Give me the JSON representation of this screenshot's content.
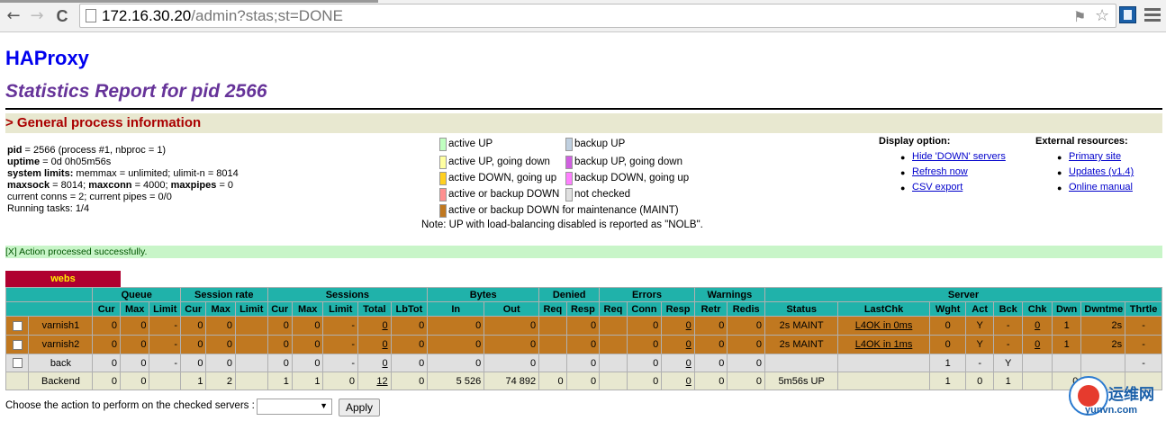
{
  "browser": {
    "url_host": "172.16.30.20",
    "url_path": "/admin?stas;st=DONE",
    "back_glyph": "←",
    "forward_glyph": "→",
    "reload_glyph": "C",
    "translate_glyph": "⚑",
    "star_glyph": "☆"
  },
  "header": {
    "title": "HAProxy",
    "subtitle": "Statistics Report for pid 2566"
  },
  "section": {
    "title": "> General process information"
  },
  "process_info": {
    "pid_label": "pid",
    "pid_value": " = 2566 (process #1, nbproc = 1)",
    "uptime_label": "uptime",
    "uptime_value": " = 0d 0h05m56s",
    "limits_label": "system limits:",
    "limits_value": " memmax = unlimited; ulimit-n = 8014",
    "maxsock_label": "maxsock",
    "maxsock_value": " = 8014; ",
    "maxconn_label": "maxconn",
    "maxconn_value": " = 4000; ",
    "maxpipes_label": "maxpipes",
    "maxpipes_value": " = 0",
    "conns_line": "current conns = 2; current pipes = 0/0",
    "tasks_line": "Running tasks: 1/4"
  },
  "legend": {
    "items": [
      {
        "label": "active UP",
        "color": "#c0ffc0"
      },
      {
        "label": "active UP, going down",
        "color": "#ffffa0"
      },
      {
        "label": "active DOWN, going up",
        "color": "#ffd020"
      },
      {
        "label": "active or backup DOWN",
        "color": "#ff9090"
      },
      {
        "label": "active or backup DOWN for maintenance (MAINT)",
        "color": "#c07820"
      },
      {
        "label": "backup UP",
        "color": "#c0d0e0"
      },
      {
        "label": "backup UP, going down",
        "color": "#d060e0"
      },
      {
        "label": "backup DOWN, going up",
        "color": "#ff80ff"
      },
      {
        "label": "not checked",
        "color": "#e0e0e0"
      }
    ],
    "note": "Note: UP with load-balancing disabled is reported as \"NOLB\"."
  },
  "display_options": {
    "heading": "Display option:",
    "links": [
      "Hide 'DOWN' servers",
      "Refresh now",
      "CSV export"
    ]
  },
  "external_resources": {
    "heading": "External resources:",
    "links": [
      "Primary site",
      "Updates (v1.4)",
      "Online manual"
    ]
  },
  "status_message": "[X] Action processed successfully.",
  "proxy": {
    "name": "webs"
  },
  "table": {
    "group_headers": [
      "Queue",
      "Session rate",
      "Sessions",
      "Bytes",
      "Denied",
      "Errors",
      "Warnings",
      "Server"
    ],
    "columns": [
      "Cur",
      "Max",
      "Limit",
      "Cur",
      "Max",
      "Limit",
      "Cur",
      "Max",
      "Limit",
      "Total",
      "LbTot",
      "In",
      "Out",
      "Req",
      "Resp",
      "Req",
      "Conn",
      "Resp",
      "Retr",
      "Redis",
      "Status",
      "LastChk",
      "Wght",
      "Act",
      "Bck",
      "Chk",
      "Dwn",
      "Dwntme",
      "Thrtle"
    ],
    "rows": [
      {
        "name": "varnish1",
        "type": "maint",
        "cells": [
          "0",
          "0",
          "-",
          "0",
          "0",
          "",
          "0",
          "0",
          "-",
          "0",
          "0",
          "0",
          "0",
          "",
          "0",
          "",
          "0",
          "0",
          "0",
          "0",
          "2s MAINT",
          "L4OK in 0ms",
          "0",
          "Y",
          "-",
          "0",
          "1",
          "2s",
          "-"
        ]
      },
      {
        "name": "varnish2",
        "type": "maint",
        "cells": [
          "0",
          "0",
          "-",
          "0",
          "0",
          "",
          "0",
          "0",
          "-",
          "0",
          "0",
          "0",
          "0",
          "",
          "0",
          "",
          "0",
          "0",
          "0",
          "0",
          "2s MAINT",
          "L4OK in 1ms",
          "0",
          "Y",
          "-",
          "0",
          "1",
          "2s",
          "-"
        ]
      },
      {
        "name": "back",
        "type": "back",
        "cells": [
          "0",
          "0",
          "-",
          "0",
          "0",
          "",
          "0",
          "0",
          "-",
          "0",
          "0",
          "0",
          "0",
          "",
          "0",
          "",
          "0",
          "0",
          "0",
          "0",
          "",
          "",
          "1",
          "-",
          "Y",
          "",
          "",
          "",
          "-"
        ]
      },
      {
        "name": "Backend",
        "type": "backend",
        "cells": [
          "0",
          "0",
          "",
          "1",
          "2",
          "",
          "1",
          "1",
          "0",
          "12",
          "0",
          "5 526",
          "74 892",
          "0",
          "0",
          "",
          "0",
          "0",
          "0",
          "0",
          "5m56s UP",
          "",
          "1",
          "0",
          "1",
          "",
          "0",
          "",
          ""
        ]
      }
    ]
  },
  "actions": {
    "prompt": "Choose the action to perform on the checked servers :",
    "select_value": "",
    "apply_label": "Apply"
  },
  "watermark": {
    "title": "运维网",
    "domain": "yunvn.com"
  }
}
